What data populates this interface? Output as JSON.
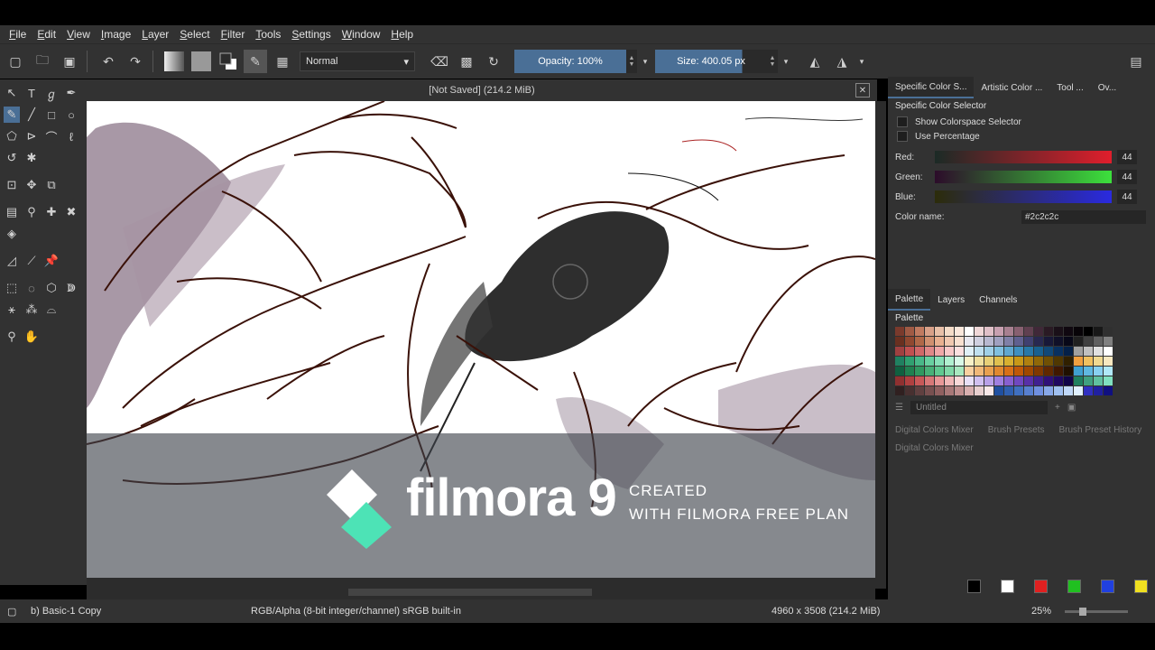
{
  "menu": [
    "File",
    "Edit",
    "View",
    "Image",
    "Layer",
    "Select",
    "Filter",
    "Tools",
    "Settings",
    "Window",
    "Help"
  ],
  "toolbar": {
    "blend_mode": "Normal",
    "opacity_label": "Opacity:  100%",
    "size_label": "Size:  400.05 px"
  },
  "document": {
    "title": "[Not Saved]  (214.2 MiB)",
    "close_glyph": "✕"
  },
  "watermark": {
    "brand": "filmora 9",
    "line1": "CREATED",
    "line2": "WITH FILMORA FREE PLAN"
  },
  "dock": {
    "top_tabs": [
      "Specific Color S...",
      "Artistic Color ...",
      "Tool ...",
      "Ov..."
    ],
    "panel_title": "Specific Color Selector",
    "show_colorspace": "Show Colorspace Selector",
    "use_percentage": "Use Percentage",
    "red_label": "Red:",
    "green_label": "Green:",
    "blue_label": "Blue:",
    "red_value": "44",
    "green_value": "44",
    "blue_value": "44",
    "color_name_label": "Color name:",
    "color_name_value": "#2c2c2c",
    "lower_tabs": [
      "Palette",
      "Layers",
      "Channels"
    ],
    "palette_label": "Palette",
    "palette_name": "Untitled",
    "bottom_tabs": [
      "Digital Colors Mixer",
      "Brush Presets",
      "Brush Preset History"
    ],
    "mixer_label": "Digital Colors Mixer",
    "basic_colors": [
      "#000000",
      "#ffffff",
      "#e02020",
      "#20c020",
      "#2040e0",
      "#f0e020"
    ]
  },
  "status": {
    "brush": "b) Basic-1 Copy",
    "colorspace": "RGB/Alpha (8-bit integer/channel)  sRGB built-in",
    "dimensions": "4960 x 3508 (214.2 MiB)",
    "zoom": "25%"
  }
}
